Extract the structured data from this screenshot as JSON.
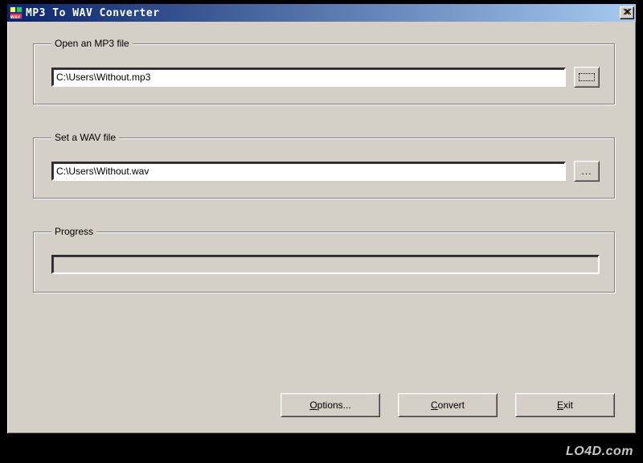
{
  "window": {
    "title": "MP3 To WAV Converter"
  },
  "open_group": {
    "legend": "Open an MP3 file",
    "path": "C:\\Users\\Without.mp3"
  },
  "save_group": {
    "legend": "Set a WAV file",
    "path": "C:\\Users\\Without.wav",
    "browse_label": "..."
  },
  "progress_group": {
    "legend": "Progress"
  },
  "buttons": {
    "options_pre": "O",
    "options_rest": "ptions...",
    "convert_pre": "C",
    "convert_rest": "onvert",
    "exit_pre": "E",
    "exit_rest": "xit"
  },
  "watermark": "LO4D.com"
}
